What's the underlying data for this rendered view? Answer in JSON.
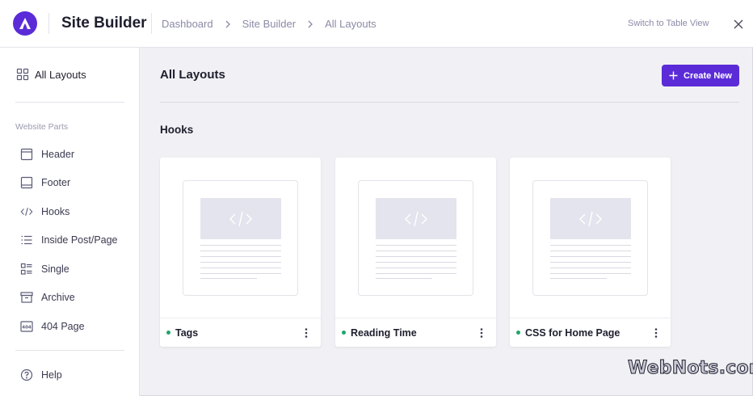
{
  "header": {
    "app_title": "Site Builder",
    "breadcrumb": [
      "Dashboard",
      "Site Builder",
      "All Layouts"
    ],
    "switch_view": "Switch to Table View",
    "close_icon": "close-icon"
  },
  "sidebar": {
    "all_layouts": "All Layouts",
    "section_label": "Website Parts",
    "items": [
      {
        "label": "Header",
        "icon": "header-icon"
      },
      {
        "label": "Footer",
        "icon": "footer-icon"
      },
      {
        "label": "Hooks",
        "icon": "code-icon"
      },
      {
        "label": "Inside Post/Page",
        "icon": "list-icon"
      },
      {
        "label": "Single",
        "icon": "single-icon"
      },
      {
        "label": "Archive",
        "icon": "archive-icon"
      },
      {
        "label": "404 Page",
        "icon": "404-icon"
      }
    ],
    "help": "Help"
  },
  "main": {
    "title": "All Layouts",
    "create_button": "Create New",
    "section": "Hooks",
    "cards": [
      {
        "name": "Tags",
        "status_color": "#1fa56b"
      },
      {
        "name": "Reading Time",
        "status_color": "#1fa56b"
      },
      {
        "name": "CSS for Home Page",
        "status_color": "#1fa56b"
      }
    ]
  },
  "watermark": "WebNots.com",
  "colors": {
    "accent": "#5b2bd8",
    "status_active": "#1fa56b"
  }
}
